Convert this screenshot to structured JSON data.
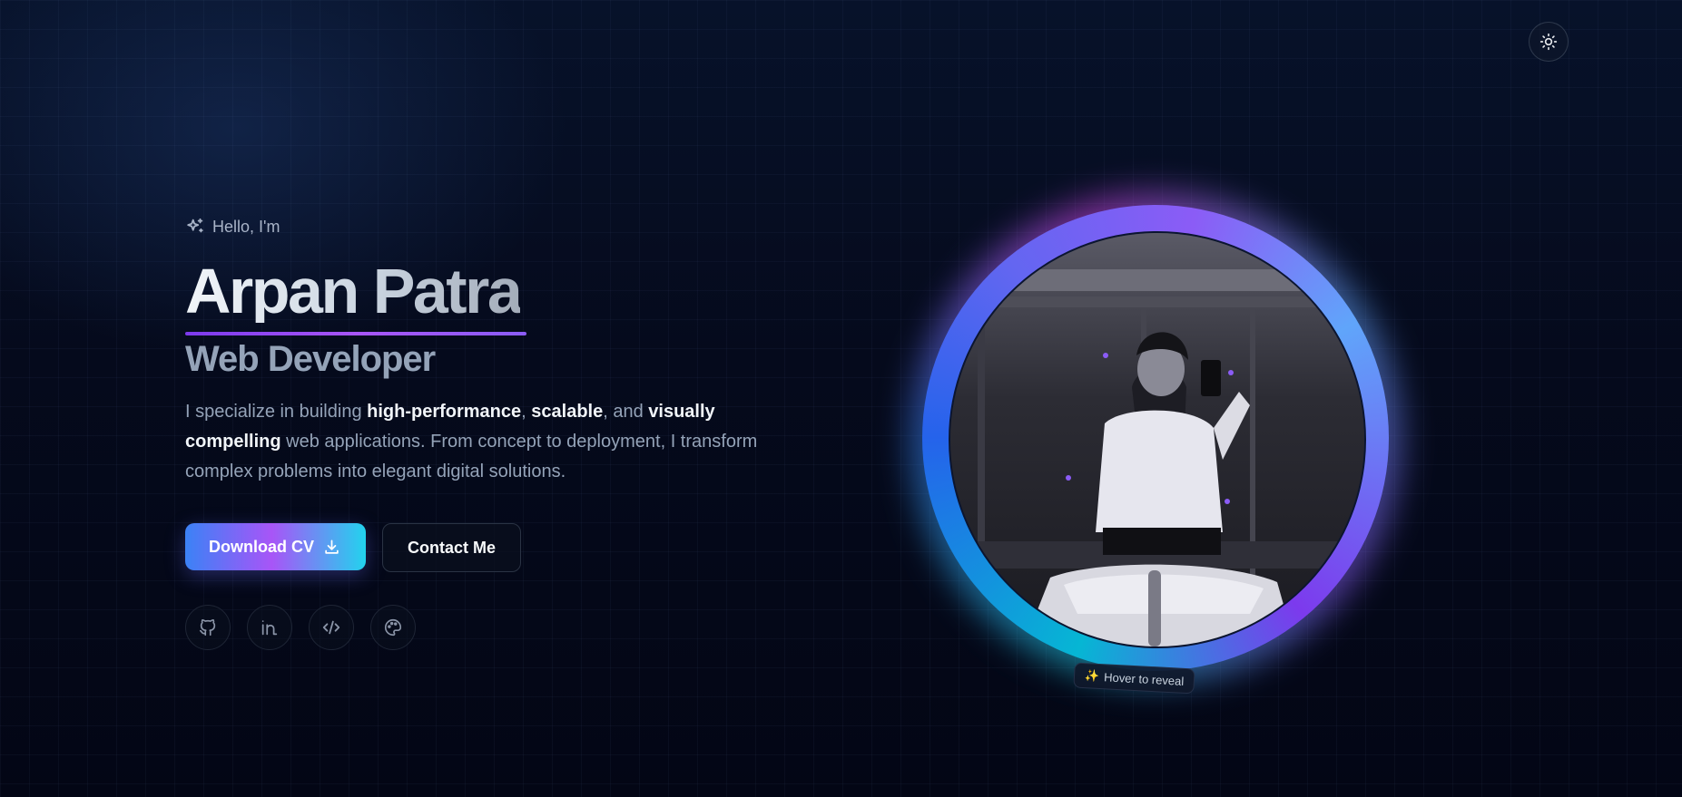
{
  "hero": {
    "greeting": "Hello, I'm",
    "name": "Arpan Patra",
    "role": "Web Developer",
    "description": {
      "part1": "I specialize in building ",
      "bold1": "high-performance",
      "part2": ", ",
      "bold2": "scalable",
      "part3": ", and ",
      "bold3": "visually compelling",
      "part4": " web applications. From concept to deployment, I transform complex problems into elegant digital solutions."
    },
    "buttons": {
      "download_cv": "Download CV",
      "contact": "Contact Me"
    },
    "socials": [
      {
        "icon": "github-icon"
      },
      {
        "icon": "linkedin-icon"
      },
      {
        "icon": "code-icon"
      },
      {
        "icon": "palette-icon"
      }
    ]
  },
  "avatar": {
    "hover_hint": "Hover to reveal",
    "hint_icon": "sparkles-icon"
  },
  "theme_toggle": {
    "icon": "sun-icon"
  },
  "colors": {
    "background": "#040816",
    "accent_purple": "#a855f7",
    "accent_blue": "#3b82f6",
    "accent_cyan": "#22d3ee",
    "text_muted": "#94a3b8"
  }
}
